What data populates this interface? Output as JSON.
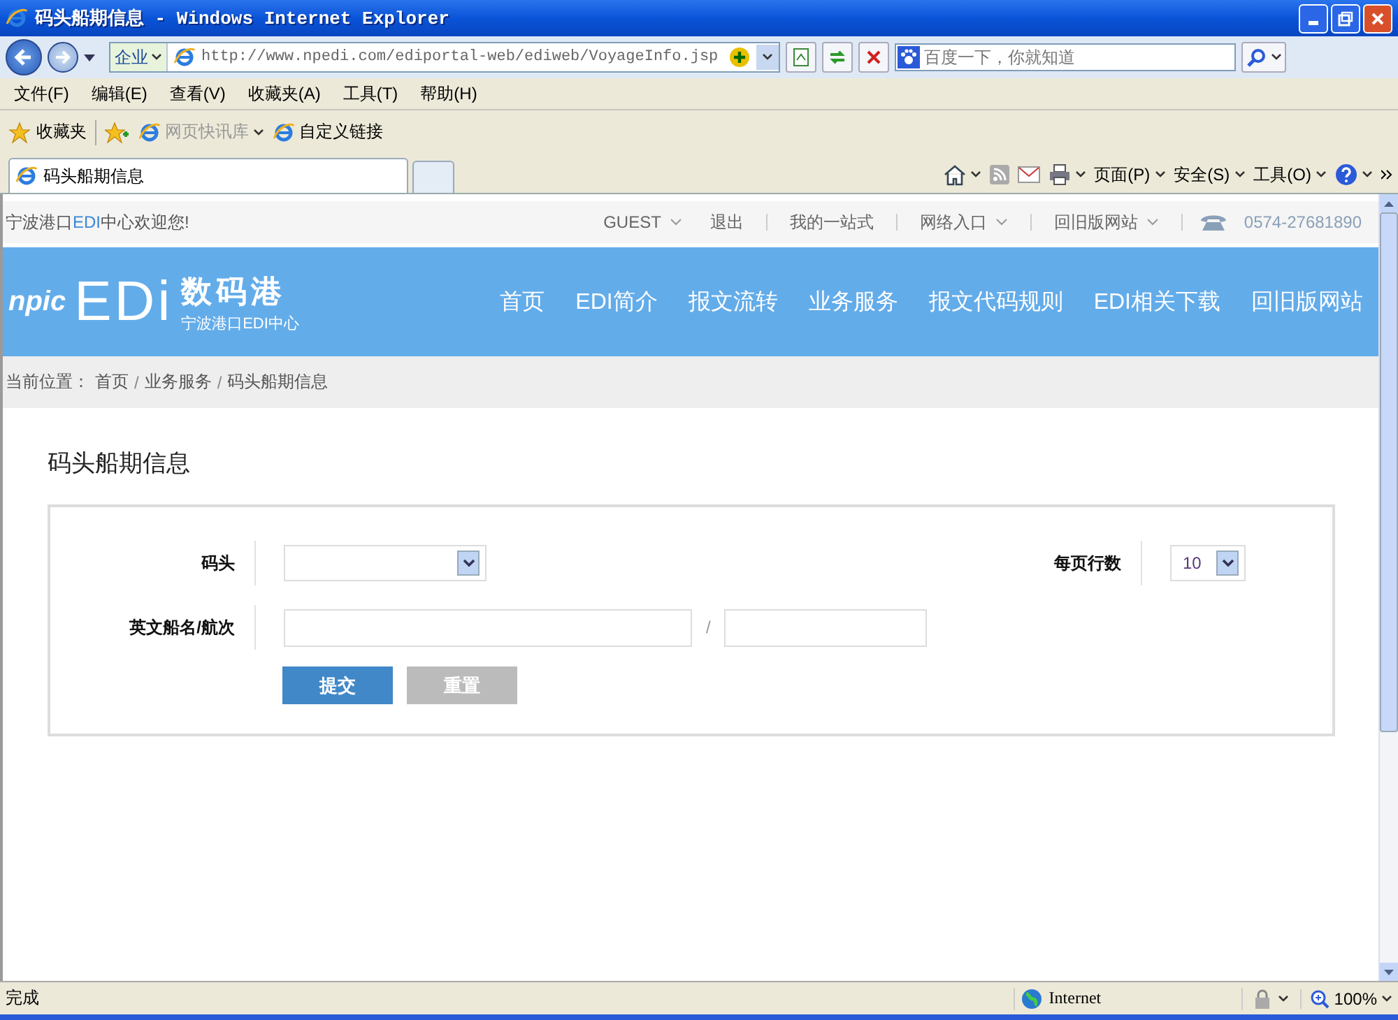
{
  "window": {
    "title": "码头船期信息 - Windows Internet Explorer"
  },
  "address_bar": {
    "scope": "企业",
    "url": "http://www.npedi.com/ediportal-web/ediweb/VoyageInfo.jsp"
  },
  "search_field": {
    "placeholder": "百度一下，你就知道"
  },
  "menu": [
    "文件(F)",
    "编辑(E)",
    "查看(V)",
    "收藏夹(A)",
    "工具(T)",
    "帮助(H)"
  ],
  "favorites_bar": {
    "favorites": "收藏夹",
    "items": [
      {
        "label": "网页快讯库",
        "disabled": true,
        "dropdown": true
      },
      {
        "label": "自定义链接",
        "disabled": false,
        "dropdown": false
      }
    ]
  },
  "tabs": [
    {
      "label": "码头船期信息",
      "selected": true
    }
  ],
  "command_bar": [
    {
      "label": "页面(P)"
    },
    {
      "label": "安全(S)"
    },
    {
      "label": "工具(O)"
    }
  ],
  "page": {
    "top_bar": {
      "welcome": {
        "before": "宁波港口",
        "highlight": "EDI",
        "after": "中心欢迎您!"
      },
      "links": [
        {
          "label": "GUEST",
          "dropdown": true
        },
        {
          "label": "退出",
          "dropdown": false
        },
        {
          "label": "我的一站式",
          "dropdown": false
        },
        {
          "label": "网络入口",
          "dropdown": true
        },
        {
          "label": "回旧版网站",
          "dropdown": true
        }
      ],
      "phone": "0574-27681890"
    },
    "banner": {
      "logo": {
        "mark": "npic",
        "brand": "EDi",
        "title": "数码港",
        "subtitle": "宁波港口EDI中心"
      },
      "nav": [
        "首页",
        "EDI简介",
        "报文流转",
        "业务服务",
        "报文代码规则",
        "EDI相关下载",
        "回旧版网站"
      ]
    },
    "breadcrumb": {
      "label": "当前位置：",
      "items": [
        {
          "label": "首页",
          "separator": "/"
        },
        {
          "label": "业务服务",
          "separator": "/"
        },
        {
          "label": "码头船期信息"
        }
      ]
    },
    "form": {
      "title": "码头船期信息",
      "terminal": {
        "label": "码头"
      },
      "rows_per_page": {
        "label": "每页行数",
        "value": "10"
      },
      "vessel": {
        "label": "英文船名/航次",
        "separator": "/"
      },
      "buttons": [
        {
          "label": "提交",
          "kind": "primary"
        },
        {
          "label": "重置",
          "kind": "secondary"
        }
      ]
    }
  },
  "status_bar": {
    "text": "完成",
    "zone": "Internet",
    "zoom": "100%"
  }
}
